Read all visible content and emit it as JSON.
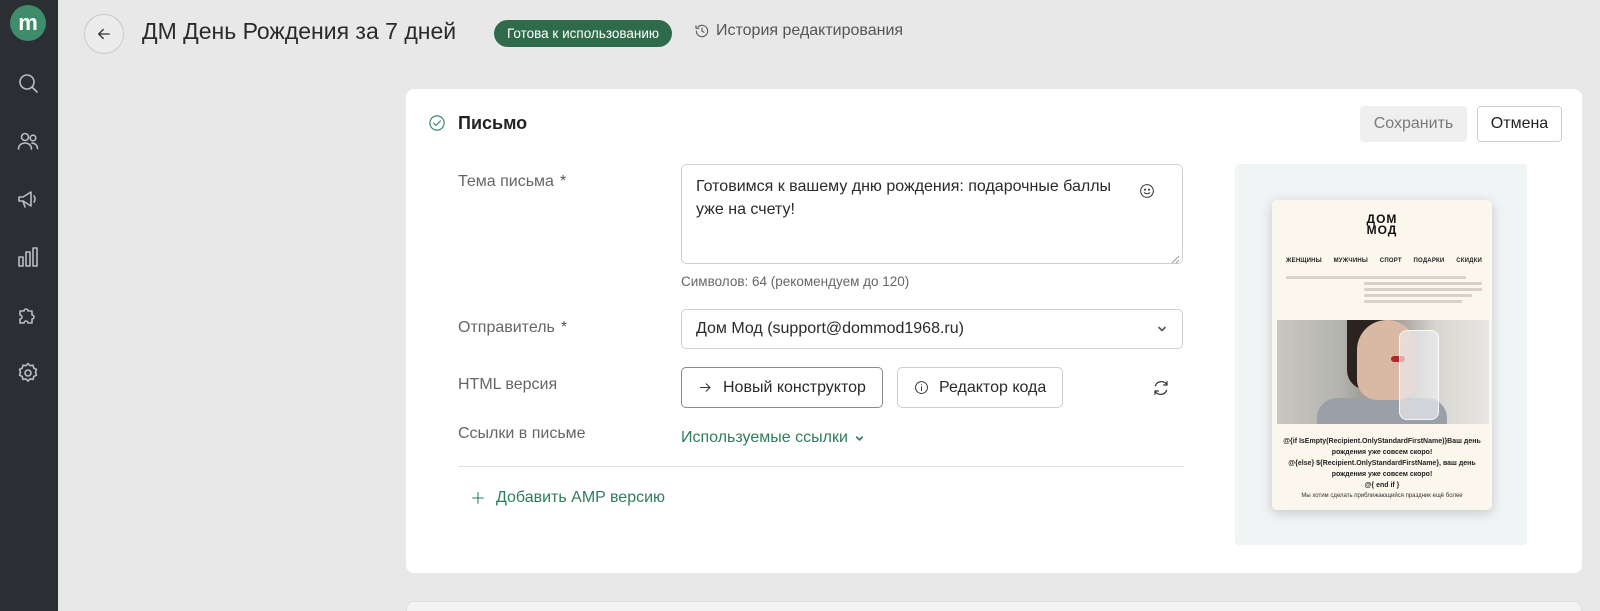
{
  "sidebar": {
    "logo_letter": "m",
    "items": [
      {
        "name": "search",
        "icon": "search-icon"
      },
      {
        "name": "users",
        "icon": "users-icon"
      },
      {
        "name": "campaigns",
        "icon": "megaphone-icon"
      },
      {
        "name": "analytics",
        "icon": "bar-chart-icon"
      },
      {
        "name": "integrations",
        "icon": "puzzle-icon"
      },
      {
        "name": "settings",
        "icon": "gear-icon"
      }
    ]
  },
  "header": {
    "title": "ДМ День Рождения за 7 дней",
    "status": "Готова к использованию",
    "history_label": "История редактирования"
  },
  "card": {
    "title": "Письмо",
    "save_label": "Сохранить",
    "cancel_label": "Отмена"
  },
  "form": {
    "subject_label": "Тема письма",
    "required_mark": "*",
    "subject_value": " Готовимся к вашему дню рождения: подарочные баллы уже на счету!",
    "char_count": "Символов: 64 (рекомендуем до 120)",
    "sender_label": "Отправитель",
    "sender_value": "Дом Мод (support@dommod1968.ru)",
    "html_label": "HTML версия",
    "new_builder_label": "Новый конструктор",
    "code_editor_label": "Редактор кода",
    "links_label": "Ссылки в письме",
    "links_toggle": "Используемые ссылки",
    "add_amp_label": "Добавить AMP версию"
  },
  "preview": {
    "brand_line1": "ДОМ",
    "brand_line2": "МОД",
    "nav": [
      "ЖЕНЩИНЫ",
      "МУЖЧИНЫ",
      "СПОРТ",
      "ПОДАРКИ",
      "СКИДКИ"
    ],
    "text_line1": "@{if IsEmpty(Recipient.OnlyStandardFirstName)}Ваш день",
    "text_line2": "рождения уже совсем скоро!",
    "text_line3": "@{else} ${Recipient.OnlyStandardFirstName}, ваш день",
    "text_line4": "рождения уже совсем скоро!",
    "text_line5": "@{ end if }",
    "footer_text": "Мы хотим сделать приближающийся праздник ещё более"
  },
  "colors": {
    "accent": "#2f7d5a",
    "badge": "#2f6b4a",
    "sidebar": "#2b2e33"
  }
}
